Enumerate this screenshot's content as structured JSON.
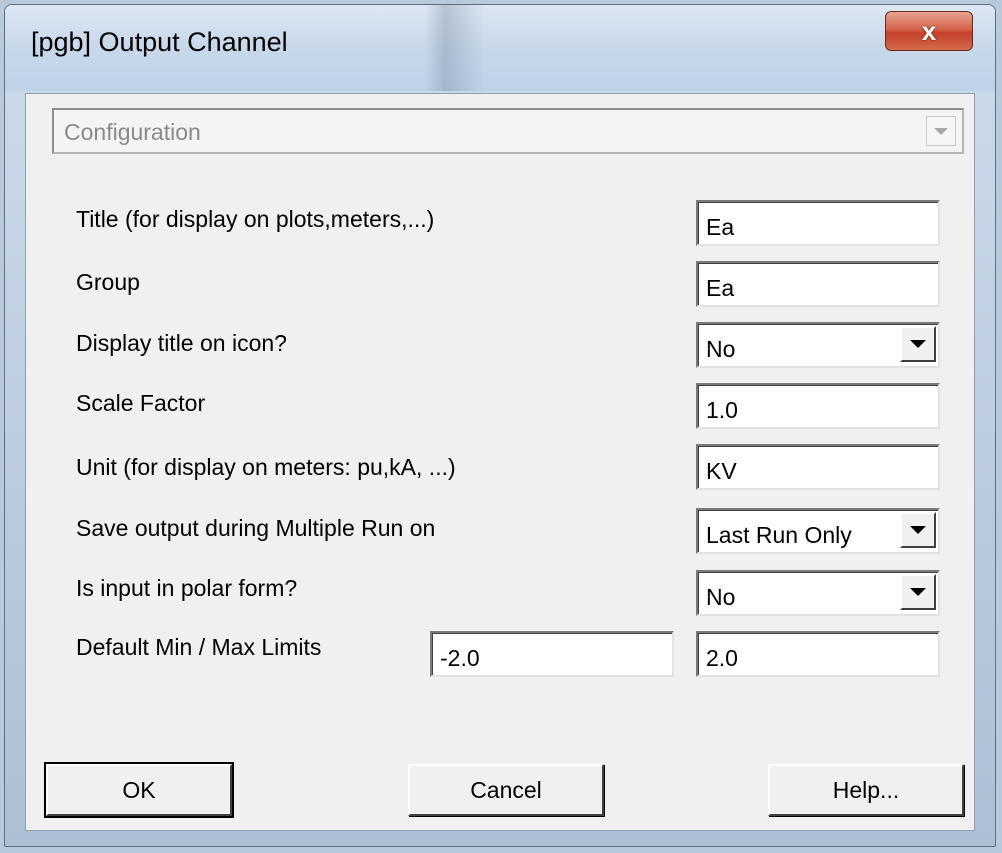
{
  "window": {
    "title": "[pgb] Output Channel",
    "close_label": "x"
  },
  "config_combo": {
    "value": "Configuration",
    "icon": "chevron-down-icon"
  },
  "fields": {
    "title": {
      "label": "Title (for display on plots,meters,...)",
      "value": "Ea"
    },
    "group": {
      "label": "Group",
      "value": "Ea"
    },
    "display_title": {
      "label": "Display title on icon?",
      "value": "No",
      "icon": "chevron-down-icon"
    },
    "scale_factor": {
      "label": "Scale Factor",
      "value": "1.0"
    },
    "unit": {
      "label": "Unit  (for display on meters: pu,kA, ...)",
      "value": "KV"
    },
    "save_output": {
      "label": "Save output during Multiple Run on",
      "value": "Last Run Only",
      "icon": "chevron-down-icon"
    },
    "polar_form": {
      "label": "Is input in polar form?",
      "value": "No",
      "icon": "chevron-down-icon"
    },
    "limits": {
      "label": "Default Min / Max  Limits",
      "min": "-2.0",
      "max": "2.0"
    }
  },
  "buttons": {
    "ok": "OK",
    "cancel": "Cancel",
    "help": "Help..."
  },
  "colors": {
    "close_button": "#c4402a",
    "dialog_background": "#f0f0f0"
  }
}
